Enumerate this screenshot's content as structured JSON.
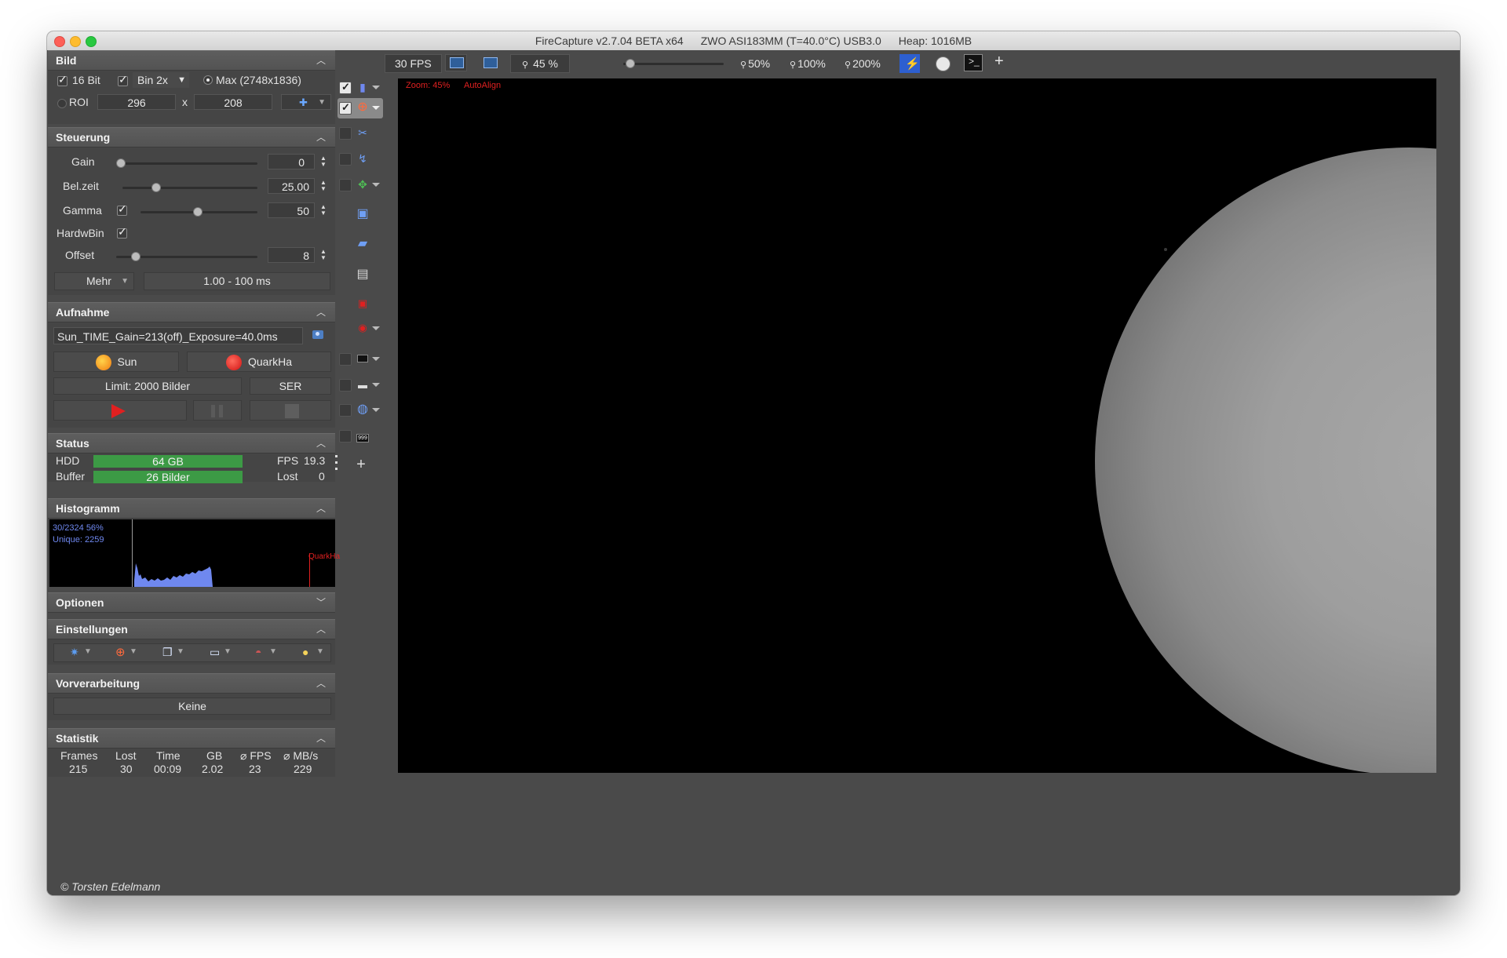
{
  "window": {
    "title_parts": [
      "FireCapture v2.7.04 BETA x64",
      "ZWO ASI183MM (T=40.0°C) USB3.0",
      "Heap: 1016MB"
    ]
  },
  "toolbar": {
    "fps": "30 FPS",
    "zoom_value": "45 %",
    "zoom_50": "50%",
    "zoom_100": "100%",
    "zoom_200": "200%",
    "add": "+"
  },
  "viewer": {
    "zoom_label": "Zoom: 45%",
    "autoalign_label": "AutoAlign"
  },
  "bild": {
    "title": "Bild",
    "bit16": "16 Bit",
    "bin": "Bin 2x",
    "max": "Max (2748x1836)",
    "roi": "ROI",
    "roi_w": "296",
    "roi_x": "x",
    "roi_h": "208"
  },
  "steuerung": {
    "title": "Steuerung",
    "gain_label": "Gain",
    "gain_value": "0",
    "gain_level": 0.0,
    "belzeit_label": "Bel.zeit",
    "belzeit_value": "25.00",
    "belzeit_level": 0.23,
    "gamma_label": "Gamma",
    "gamma_value": "50",
    "gamma_level": 0.48,
    "hardwbin_label": "HardwBin",
    "offset_label": "Offset",
    "offset_value": "8",
    "offset_level": 0.11,
    "mehr_label": "Mehr",
    "range_label": "1.00 - 100 ms"
  },
  "aufnahme": {
    "title": "Aufnahme",
    "filename": "Sun_TIME_Gain=213(off)_Exposure=40.0ms",
    "profile_sun": "Sun",
    "profile_quark": "QuarkHa",
    "limit": "Limit: 2000 Bilder",
    "format": "SER"
  },
  "status": {
    "title": "Status",
    "hdd_label": "HDD",
    "hdd_value": "64 GB",
    "buffer_label": "Buffer",
    "buffer_value": "26  Bilder",
    "fps_label": "FPS",
    "fps_value": "19.3",
    "lost_label": "Lost",
    "lost_value": "0"
  },
  "histogramm": {
    "title": "Histogramm",
    "stat1": "30/2324 56%",
    "stat2": "Unique: 2259",
    "marker": "QuarkHa"
  },
  "optionen": {
    "title": "Optionen"
  },
  "einstellungen": {
    "title": "Einstellungen"
  },
  "vorverarbeitung": {
    "title": "Vorverarbeitung",
    "value": "Keine"
  },
  "statistik": {
    "title": "Statistik",
    "headers": [
      "Frames",
      "Lost",
      "Time",
      "GB",
      "⌀ FPS",
      "⌀ MB/s"
    ],
    "values": [
      "215",
      "30",
      "00:09",
      "2.02",
      "23",
      "229"
    ]
  },
  "footer": {
    "copyright": "© Torsten Edelmann"
  },
  "colors": {
    "window_bg": "#4a4a4a",
    "bar_green": "#3c9a45",
    "hist_fill": "#6f88ef",
    "overlay_red": "#e02020"
  }
}
